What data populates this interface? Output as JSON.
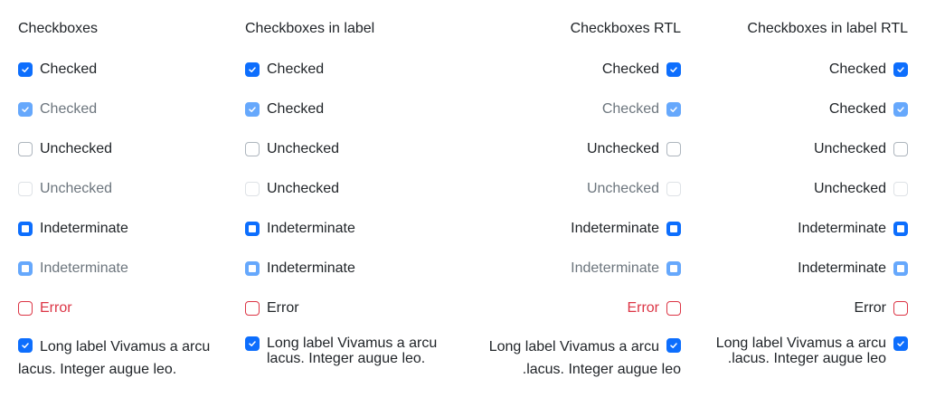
{
  "colors": {
    "accent": "#0d6efd",
    "accent_disabled": "#66a8fc",
    "error": "#dc3545",
    "border": "#adb5bd"
  },
  "columns": [
    {
      "title": "Checkboxes",
      "rtl": false,
      "in_label": false,
      "items": [
        {
          "label": "Checked",
          "state": "checked",
          "disabled": false,
          "error": false
        },
        {
          "label": "Checked",
          "state": "checked",
          "disabled": true,
          "error": false
        },
        {
          "label": "Unchecked",
          "state": "unchecked",
          "disabled": false,
          "error": false
        },
        {
          "label": "Unchecked",
          "state": "unchecked",
          "disabled": true,
          "error": false
        },
        {
          "label": "Indeterminate",
          "state": "indeterminate",
          "disabled": false,
          "error": false
        },
        {
          "label": "Indeterminate",
          "state": "indeterminate",
          "disabled": true,
          "error": false
        },
        {
          "label": "Error",
          "state": "unchecked",
          "disabled": false,
          "error": true
        },
        {
          "label": "Long label Vivamus a arcu lacus. Integer augue leo.",
          "state": "checked",
          "disabled": false,
          "error": false,
          "long": true
        }
      ]
    },
    {
      "title": "Checkboxes in label",
      "rtl": false,
      "in_label": true,
      "items": [
        {
          "label": "Checked",
          "state": "checked",
          "disabled": false,
          "error": false
        },
        {
          "label": "Checked",
          "state": "checked",
          "disabled": true,
          "error": false
        },
        {
          "label": "Unchecked",
          "state": "unchecked",
          "disabled": false,
          "error": false
        },
        {
          "label": "Unchecked",
          "state": "unchecked",
          "disabled": true,
          "error": false
        },
        {
          "label": "Indeterminate",
          "state": "indeterminate",
          "disabled": false,
          "error": false
        },
        {
          "label": "Indeterminate",
          "state": "indeterminate",
          "disabled": true,
          "error": false
        },
        {
          "label": "Error",
          "state": "unchecked",
          "disabled": false,
          "error": true
        },
        {
          "label": "Long label Vivamus a arcu lacus. Integer augue leo.",
          "state": "checked",
          "disabled": false,
          "error": false,
          "long": true
        }
      ]
    },
    {
      "title": "Checkboxes RTL",
      "rtl": true,
      "in_label": false,
      "items": [
        {
          "label": "Checked",
          "state": "checked",
          "disabled": false,
          "error": false
        },
        {
          "label": "Checked",
          "state": "checked",
          "disabled": true,
          "error": false
        },
        {
          "label": "Unchecked",
          "state": "unchecked",
          "disabled": false,
          "error": false
        },
        {
          "label": "Unchecked",
          "state": "unchecked",
          "disabled": true,
          "error": false
        },
        {
          "label": "Indeterminate",
          "state": "indeterminate",
          "disabled": false,
          "error": false
        },
        {
          "label": "Indeterminate",
          "state": "indeterminate",
          "disabled": true,
          "error": false
        },
        {
          "label": "Error",
          "state": "unchecked",
          "disabled": false,
          "error": true
        },
        {
          "label": "Long label Vivamus a arcu lacus. Integer augue leo.",
          "state": "checked",
          "disabled": false,
          "error": false,
          "long": true
        }
      ]
    },
    {
      "title": "Checkboxes in label RTL",
      "rtl": true,
      "in_label": true,
      "items": [
        {
          "label": "Checked",
          "state": "checked",
          "disabled": false,
          "error": false
        },
        {
          "label": "Checked",
          "state": "checked",
          "disabled": true,
          "error": false
        },
        {
          "label": "Unchecked",
          "state": "unchecked",
          "disabled": false,
          "error": false
        },
        {
          "label": "Unchecked",
          "state": "unchecked",
          "disabled": true,
          "error": false
        },
        {
          "label": "Indeterminate",
          "state": "indeterminate",
          "disabled": false,
          "error": false
        },
        {
          "label": "Indeterminate",
          "state": "indeterminate",
          "disabled": true,
          "error": false
        },
        {
          "label": "Error",
          "state": "unchecked",
          "disabled": false,
          "error": true
        },
        {
          "label": "Long label Vivamus a arcu lacus. Integer augue leo.",
          "state": "checked",
          "disabled": false,
          "error": false,
          "long": true
        }
      ]
    }
  ]
}
